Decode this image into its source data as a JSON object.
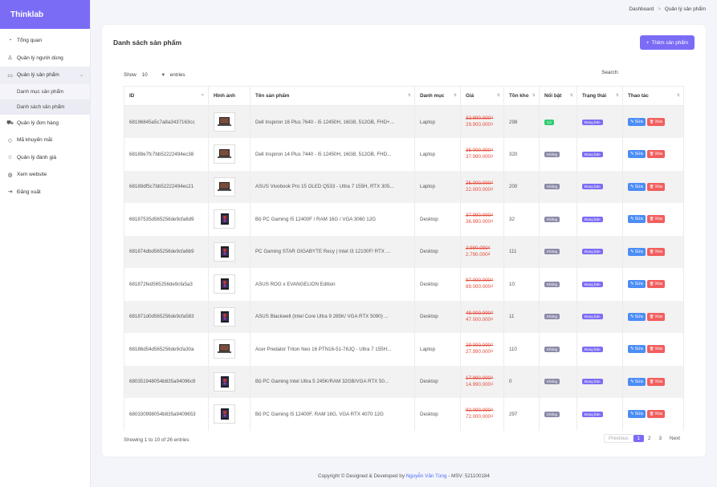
{
  "brand": "Thinklab",
  "sidebar": {
    "items": [
      {
        "label": "Tổng quan",
        "icon": "dashboard-icon"
      },
      {
        "label": "Quản lý người dùng",
        "icon": "user-icon"
      },
      {
        "label": "Quản lý sản phẩm",
        "icon": "monitor-icon"
      },
      {
        "label": "Quản lý đơn hàng",
        "icon": "cart-icon"
      },
      {
        "label": "Mã khuyến mãi",
        "icon": "tag-icon"
      },
      {
        "label": "Quản lý đánh giá",
        "icon": "star-icon"
      },
      {
        "label": "Xem website",
        "icon": "globe-icon"
      },
      {
        "label": "Đăng xuất",
        "icon": "logout-icon"
      }
    ],
    "sub_items": [
      "Danh mục sản phẩm",
      "Danh sách sản phẩm"
    ]
  },
  "breadcrumb": {
    "home": "Dashboard",
    "sep": ">",
    "current": "Quản lý sản phẩm"
  },
  "card": {
    "title": "Danh sách sản phẩm",
    "add_button": "Thêm sản phẩm",
    "show_label": "Show",
    "show_value": "10",
    "entries_label": "entries",
    "search_label": "Search:"
  },
  "table": {
    "headers": [
      "ID",
      "Hình ảnh",
      "Tên sản phẩm",
      "Danh mục",
      "Giá",
      "Tồn kho",
      "Nổi bật",
      "Trạng thái",
      "Thao tác"
    ],
    "rows": [
      {
        "id": "68196845a5c7a8a3437163cc",
        "name": "Dell Inspiron 16 Plus 7640 - i5 12450H, 16GB, 512GB, FHD+...",
        "category": "Laptop",
        "old_price": "32.990.000₫",
        "new_price": "29.900.000₫",
        "stock": "298",
        "featured": "Có",
        "status": "Đang bán",
        "img": "laptop"
      },
      {
        "id": "68189e7fc7bb52222494ec38",
        "name": "Dell Inspiron 14 Plus 7440 - i5 12450H, 16GB, 512GB, FHD...",
        "category": "Laptop",
        "old_price": "35.000.000₫",
        "new_price": "37.990.000₫",
        "stock": "320",
        "featured": "Không",
        "status": "Đang bán",
        "img": "laptop"
      },
      {
        "id": "68189df5c7bb52222494ec21",
        "name": "ASUS Vivobook Pro 15 OLED Q533 - Ultra 7 155H, RTX 305...",
        "category": "Laptop",
        "old_price": "25.000.000₫",
        "new_price": "22.000.000₫",
        "stock": "200",
        "featured": "Không",
        "status": "Đang bán",
        "img": "laptop"
      },
      {
        "id": "68187535d565256de9cfa6d9",
        "name": "Bộ PC Gaming I5 12400F / RAM 16G / VGA 3060 12G",
        "category": "Desktop",
        "old_price": "37.990.000₫",
        "new_price": "36.990.000₫",
        "stock": "32",
        "featured": "Không",
        "status": "Đang bán",
        "img": "desktop"
      },
      {
        "id": "681874dbd565256de9cfa6b9",
        "name": "PC Gaming STAR GIGABYTE Recy | Intel I3 12100F/ RTX ...",
        "category": "Desktop",
        "old_price": "2.990.000₫",
        "new_price": "2.790.000₫",
        "stock": "111",
        "featured": "Không",
        "status": "Đang bán",
        "img": "desktop"
      },
      {
        "id": "681872fed565256de9cfa5a3",
        "name": "ASUS ROG x EVANGELION Edition",
        "category": "Desktop",
        "old_price": "97.000.000₫",
        "new_price": "89.000.000₫",
        "stock": "10",
        "featured": "Không",
        "status": "Đang bán",
        "img": "desktop"
      },
      {
        "id": "681871d0d565256de9cfa583",
        "name": "ASUS Blackwell (Intel Core Ultra 9 285K/ VGA RTX 5090) ...",
        "category": "Desktop",
        "old_price": "49.000.000₫",
        "new_price": "47.000.000₫",
        "stock": "11",
        "featured": "Không",
        "status": "Đang bán",
        "img": "desktop"
      },
      {
        "id": "68186d54d565256de9cfa30a",
        "name": "Acer Predator Triton Neo 16 PTN16-51-78JQ - Ultra 7 155H...",
        "category": "Laptop",
        "old_price": "29.000.000₫",
        "new_price": "27.990.000₫",
        "stock": "110",
        "featured": "Không",
        "status": "Đang bán",
        "img": "laptop"
      },
      {
        "id": "680351948054b835a94096c9",
        "name": "Bộ PC Gaming Intel Ultra 5 245K/RAM 32GB/VGA RTX 50...",
        "category": "Desktop",
        "old_price": "17.990.000₫",
        "new_price": "14.990.000₫",
        "stock": "0",
        "featured": "Không",
        "status": "Đang bán",
        "img": "desktop"
      },
      {
        "id": "680330998054b835a9409653",
        "name": "Bộ PC Gaming I5 12400F, RAM 16G, VGA RTX 4070 12G",
        "category": "Desktop",
        "old_price": "92.000.000₫",
        "new_price": "72.000.000₫",
        "stock": "297",
        "featured": "Không",
        "status": "Đang bán",
        "img": "desktop"
      }
    ],
    "edit_label": "Sửa",
    "delete_label": "Xóa"
  },
  "info": "Showing 1 to 10 of 26 entries",
  "pagination": {
    "prev": "Previous",
    "pages": [
      "1",
      "2",
      "3"
    ],
    "next": "Next",
    "current": "1"
  },
  "footer": {
    "text": "Copyright © Designed & Developed by ",
    "author": "Nguyễn Văn Tùng",
    "suffix": " - MSV: 521100184"
  },
  "colors": {
    "accent": "#7b6cf6",
    "edit": "#4c8df6",
    "delete": "#f25e5e",
    "price": "#e74c3c"
  }
}
